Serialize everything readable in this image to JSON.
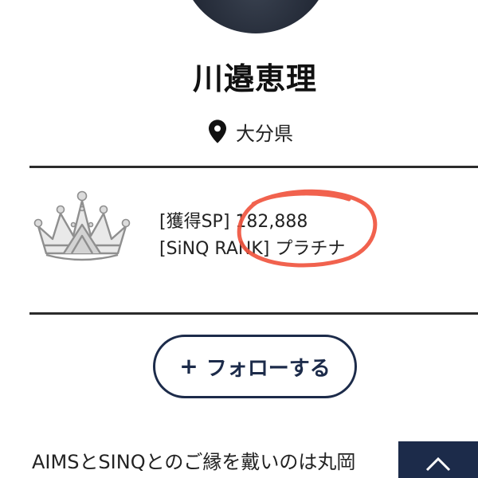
{
  "profile": {
    "name": "川邉恵理",
    "location": "大分県"
  },
  "stats": {
    "sp_label": "[獲得SP]",
    "sp_value": "182,888",
    "rank_label": "[SiNQ RANK]",
    "rank_value": "プラチナ"
  },
  "actions": {
    "follow_label": "フォローする",
    "follow_icon": "plus-icon"
  },
  "bio": {
    "text": "AIMSとSINQとのご縁を戴いのは丸岡"
  },
  "colors": {
    "navy": "#1c2b4a",
    "highlight": "#f0553f",
    "text": "#222222"
  },
  "icons": [
    "pin-icon",
    "crown-icon",
    "plus-icon",
    "chevron-up-icon"
  ]
}
